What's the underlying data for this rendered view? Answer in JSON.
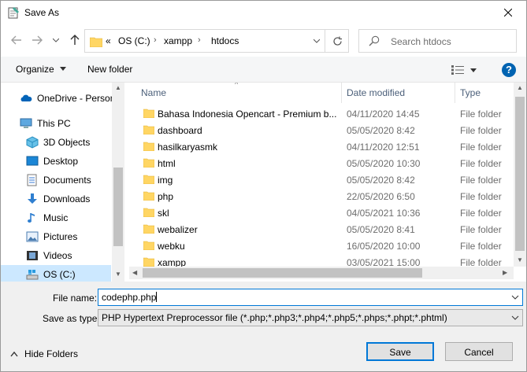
{
  "window": {
    "title": "Save As"
  },
  "nav": {
    "path": [
      "«",
      "OS (C:)",
      "xampp",
      "htdocs"
    ],
    "search_placeholder": "Search htdocs"
  },
  "toolbar": {
    "organize": "Organize",
    "new_folder": "New folder",
    "help": "?"
  },
  "sidebar": {
    "items": [
      {
        "label": "OneDrive - Personal",
        "icon": "cloud-icon"
      },
      {
        "label": "This PC",
        "icon": "computer-icon"
      },
      {
        "label": "3D Objects",
        "icon": "cube-icon"
      },
      {
        "label": "Desktop",
        "icon": "desktop-icon"
      },
      {
        "label": "Documents",
        "icon": "documents-icon"
      },
      {
        "label": "Downloads",
        "icon": "download-icon"
      },
      {
        "label": "Music",
        "icon": "music-icon"
      },
      {
        "label": "Pictures",
        "icon": "pictures-icon"
      },
      {
        "label": "Videos",
        "icon": "videos-icon"
      },
      {
        "label": "OS (C:)",
        "icon": "drive-icon"
      }
    ]
  },
  "files": {
    "columns": [
      "Name",
      "Date modified",
      "Type"
    ],
    "rows": [
      {
        "name": "Bahasa Indonesia Opencart - Premium b...",
        "date": "04/11/2020 14:45",
        "type": "File folder"
      },
      {
        "name": "dashboard",
        "date": "05/05/2020 8:42",
        "type": "File folder"
      },
      {
        "name": "hasilkaryasmk",
        "date": "04/11/2020 12:51",
        "type": "File folder"
      },
      {
        "name": "html",
        "date": "05/05/2020 10:30",
        "type": "File folder"
      },
      {
        "name": "img",
        "date": "05/05/2020 8:42",
        "type": "File folder"
      },
      {
        "name": "php",
        "date": "22/05/2020 6:50",
        "type": "File folder"
      },
      {
        "name": "skl",
        "date": "04/05/2021 10:36",
        "type": "File folder"
      },
      {
        "name": "webalizer",
        "date": "05/05/2020 8:41",
        "type": "File folder"
      },
      {
        "name": "webku",
        "date": "16/05/2020 10:00",
        "type": "File folder"
      },
      {
        "name": "xampp",
        "date": "03/05/2021 15:00",
        "type": "File folder"
      }
    ]
  },
  "form": {
    "filename_label": "File name:",
    "filename_value": "codephp.php",
    "savetype_label": "Save as type:",
    "savetype_value": "PHP Hypertext Preprocessor file (*.php;*.php3;*.php4;*.php5;*.phps;*.phpt;*.phtml)",
    "hide_folders": "Hide Folders",
    "save": "Save",
    "cancel": "Cancel"
  },
  "colors": {
    "accent": "#0078d7",
    "folder": "#ffd664",
    "selected": "#cce8ff"
  }
}
